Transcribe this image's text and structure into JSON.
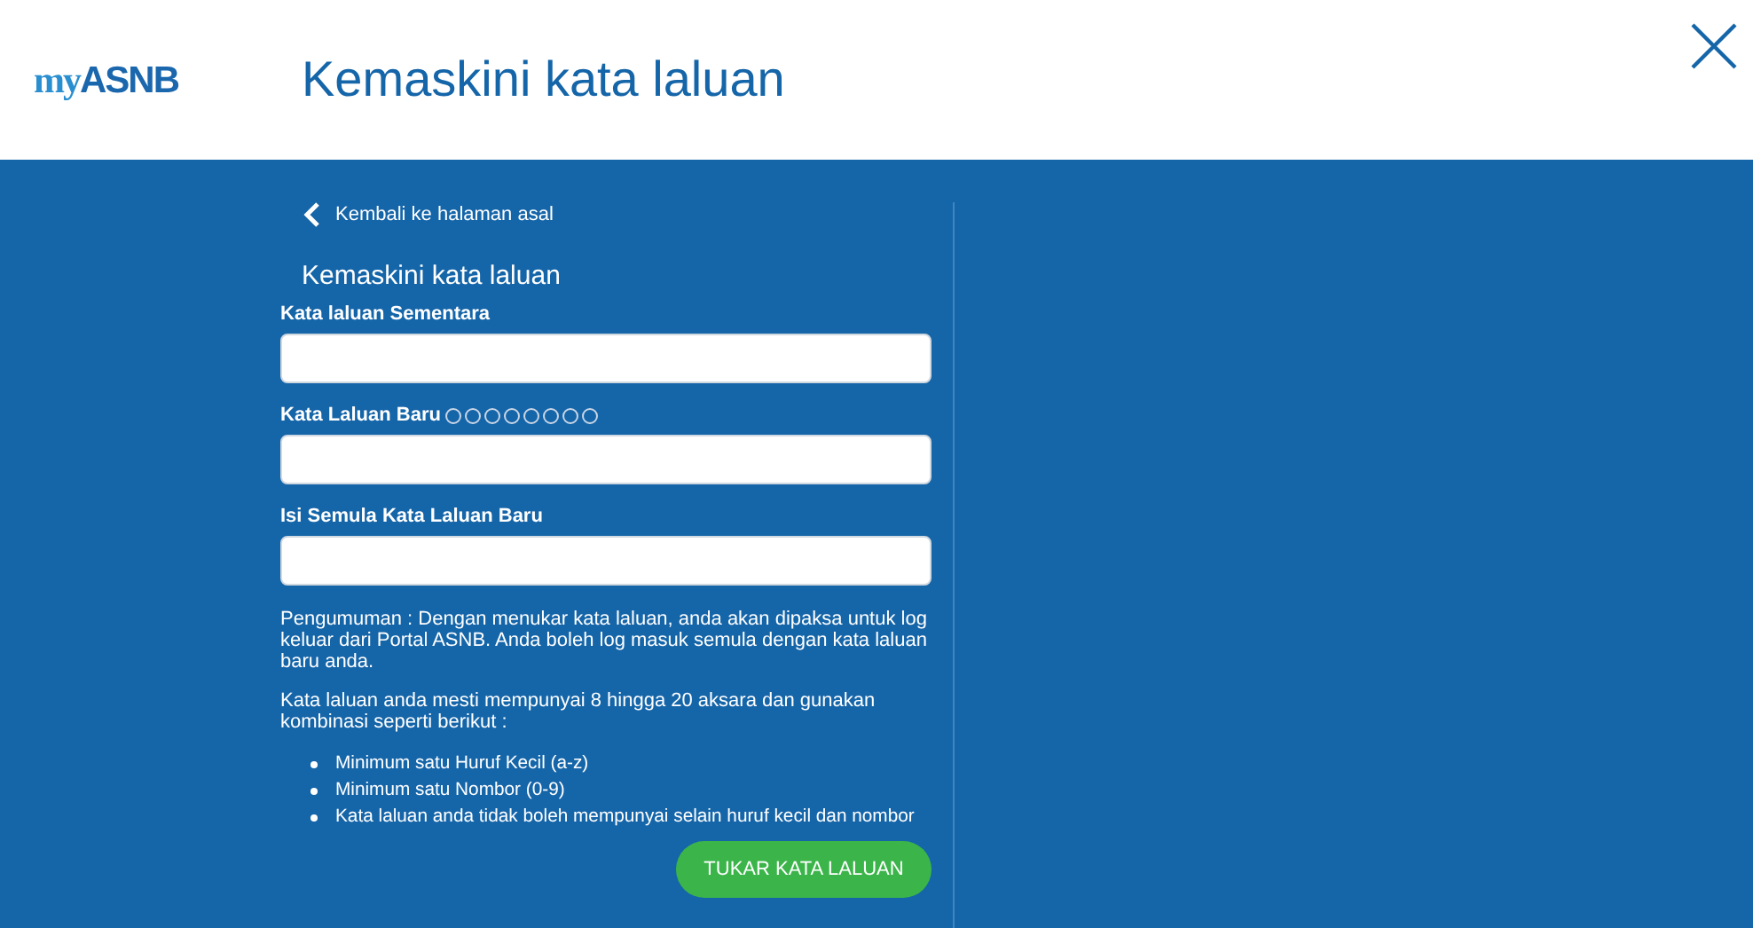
{
  "header": {
    "logo": {
      "prefix": "my",
      "name": "ASNB"
    },
    "title": "Kemaskini kata laluan"
  },
  "back_link": "Kembali ke halaman asal",
  "form_title": "Kemaskini kata laluan",
  "fields": [
    {
      "label": "Kata laluan Sementara"
    },
    {
      "label": "Kata Laluan Baru",
      "strength_dots": [
        {
          "filled": false
        },
        {
          "filled": false
        },
        {
          "filled": false
        },
        {
          "filled": false
        },
        {
          "filled": false
        },
        {
          "filled": false
        },
        {
          "filled": false
        },
        {
          "filled": false
        }
      ]
    },
    {
      "label": "Isi Semula Kata Laluan Baru"
    }
  ],
  "notice": "Pengumuman : Dengan menukar kata laluan, anda akan dipaksa untuk log keluar dari Portal ASNB. Anda boleh log masuk semula dengan kata laluan baru anda.",
  "rules_intro": "Kata laluan anda mesti mempunyai 8 hingga 20 aksara dan gunakan kombinasi seperti berikut :",
  "rules": [
    "Minimum satu Huruf Kecil (a-z)",
    "Minimum satu Nombor (0-9)",
    "Kata laluan anda tidak boleh mempunyai selain huruf kecil dan nombor"
  ],
  "submit": "TUKAR KATA LALUAN"
}
